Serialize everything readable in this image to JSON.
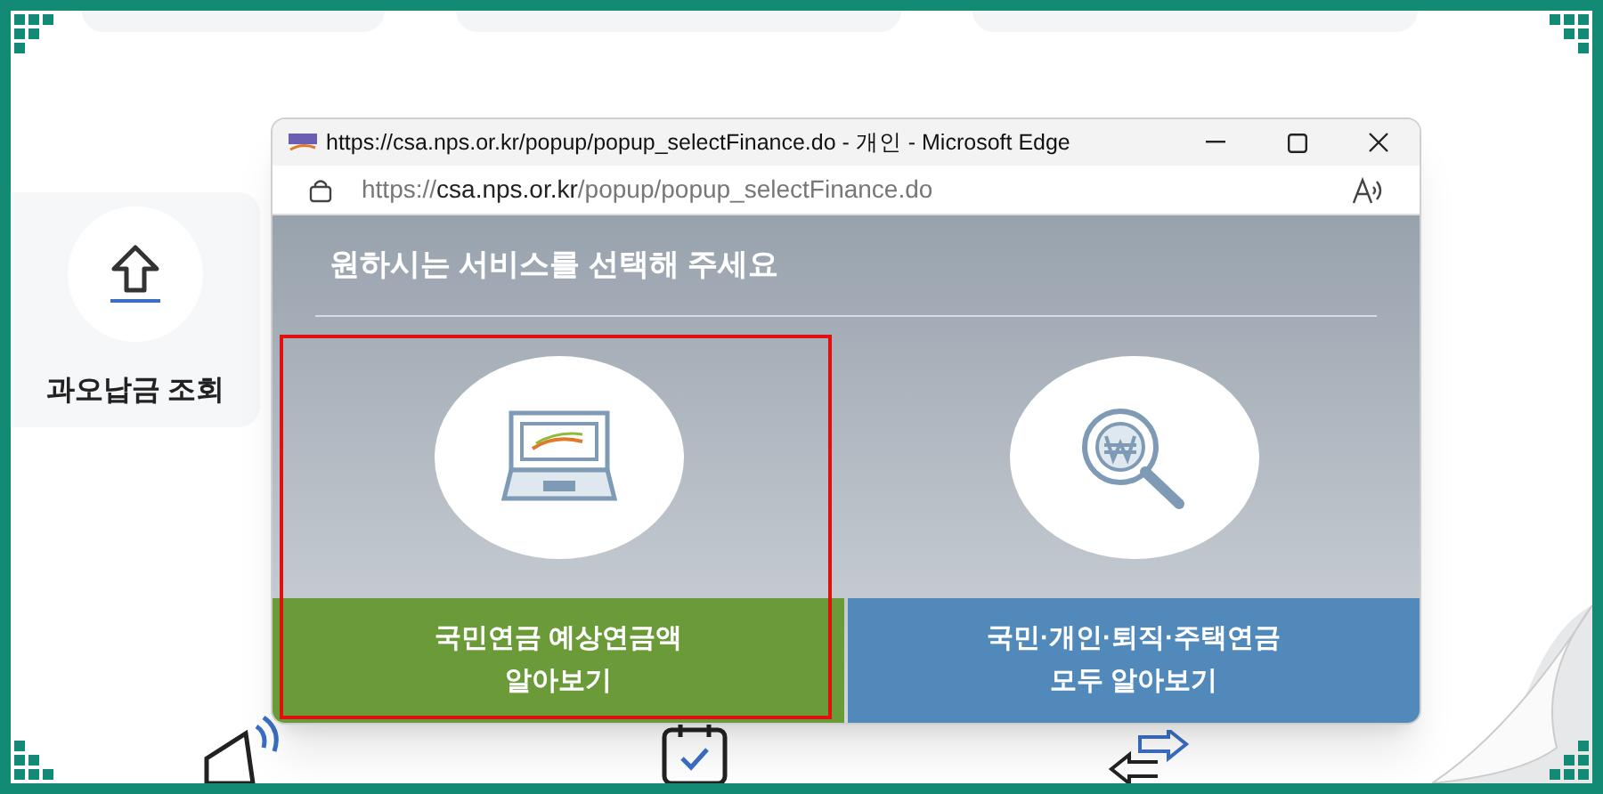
{
  "background_page": {
    "menu_item": "과오납금 조회"
  },
  "browser_window": {
    "title": "https://csa.nps.or.kr/popup/popup_selectFinance.do - 개인 - Microsoft Edge",
    "url_scheme": "https://",
    "url_host": "csa.nps.or.kr",
    "url_path": "/popup/popup_selectFinance.do"
  },
  "heading": "원하시는 서비스를 선택해 주세요",
  "options": [
    {
      "kind": "laptop",
      "label": "국민연금 예상연금액\n알아보기",
      "color": "#6b9a38",
      "highlighted": true
    },
    {
      "kind": "magnifier",
      "label": "국민·개인·퇴직·주택연금\n모두 알아보기",
      "color": "#5189bb",
      "highlighted": false
    }
  ]
}
